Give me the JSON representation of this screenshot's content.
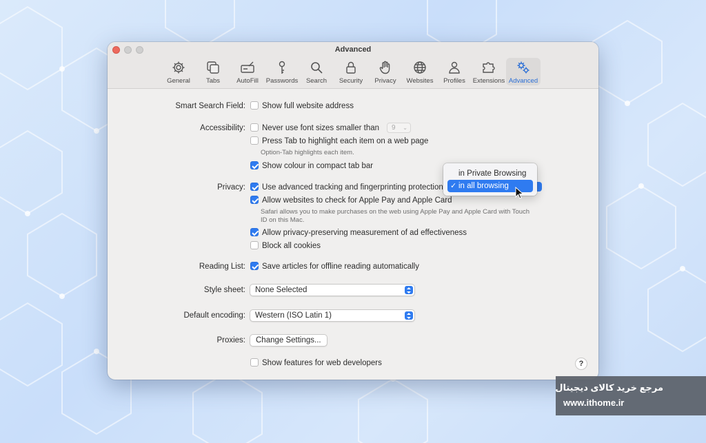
{
  "window": {
    "title": "Advanced"
  },
  "toolbar": {
    "items": [
      {
        "label": "General",
        "icon": "gear-icon"
      },
      {
        "label": "Tabs",
        "icon": "tabs-icon"
      },
      {
        "label": "AutoFill",
        "icon": "autofill-icon"
      },
      {
        "label": "Passwords",
        "icon": "key-icon"
      },
      {
        "label": "Search",
        "icon": "search-icon"
      },
      {
        "label": "Security",
        "icon": "lock-icon"
      },
      {
        "label": "Privacy",
        "icon": "hand-icon"
      },
      {
        "label": "Websites",
        "icon": "globe-icon"
      },
      {
        "label": "Profiles",
        "icon": "person-icon"
      },
      {
        "label": "Extensions",
        "icon": "puzzle-icon"
      },
      {
        "label": "Advanced",
        "icon": "gears-icon"
      }
    ],
    "active": "Advanced"
  },
  "settings": {
    "smart_search": {
      "label": "Smart Search Field:",
      "option": "Show full website address",
      "checked": false
    },
    "accessibility": {
      "label": "Accessibility:",
      "min_font": {
        "option": "Never use font sizes smaller than",
        "checked": false,
        "value": "9"
      },
      "tab_highlight": {
        "option": "Press Tab to highlight each item on a web page",
        "checked": false,
        "note": "Option-Tab highlights each item."
      },
      "compact_colour": {
        "option": "Show colour in compact tab bar",
        "checked": true
      }
    },
    "privacy": {
      "label": "Privacy:",
      "tracking": {
        "option": "Use advanced tracking and fingerprinting protection",
        "checked": true
      },
      "apple_pay": {
        "option": "Allow websites to check for Apple Pay and Apple Card",
        "checked": true,
        "note": "Safari allows you to make purchases on the web using Apple Pay and Apple Card with Touch ID on this Mac."
      },
      "ad_measurement": {
        "option": "Allow privacy-preserving measurement of ad effectiveness",
        "checked": true
      },
      "block_cookies": {
        "option": "Block all cookies",
        "checked": false
      }
    },
    "reading_list": {
      "label": "Reading List:",
      "option": "Save articles for offline reading automatically",
      "checked": true
    },
    "style_sheet": {
      "label": "Style sheet:",
      "value": "None Selected"
    },
    "encoding": {
      "label": "Default encoding:",
      "value": "Western (ISO Latin 1)"
    },
    "proxies": {
      "label": "Proxies:",
      "button": "Change Settings..."
    },
    "developer": {
      "option": "Show features for web developers",
      "checked": false
    },
    "help": "?"
  },
  "tracking_menu": {
    "items": [
      "in Private Browsing",
      "in all browsing"
    ],
    "selected": "in all browsing",
    "checkmark": "✓"
  },
  "watermark": {
    "text_fa": "مرجع خرید کالای دیجیتال",
    "url": "www.ithome.ir"
  },
  "colors": {
    "accent": "#2f7bf0",
    "window_bg": "#f0efee",
    "close_red": "#ed6a5e"
  }
}
